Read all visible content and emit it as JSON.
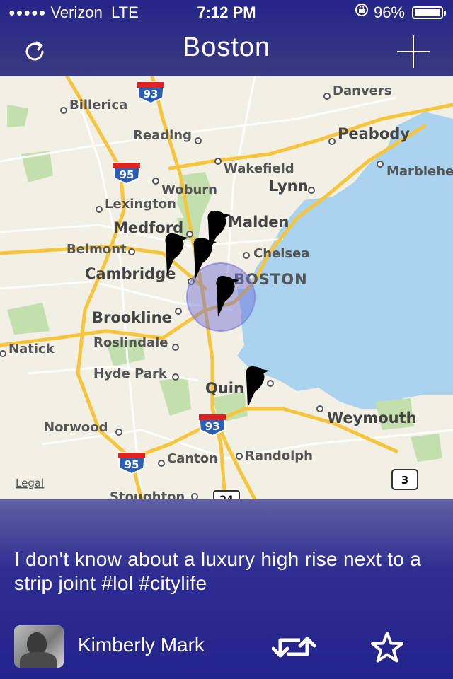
{
  "status_bar": {
    "signal_dots": "●●●●●",
    "carrier": "Verizon",
    "network": "LTE",
    "time": "7:12 PM",
    "battery_percent": "96%",
    "battery_level": 0.96
  },
  "navbar": {
    "title": "Boston",
    "refresh_icon": "refresh-icon",
    "add_icon": "plus-icon"
  },
  "map": {
    "legal_label": "Legal",
    "places": {
      "danvers": "Danvers",
      "billerica": "Billerica",
      "reading": "Reading",
      "peabody": "Peabody",
      "wakefield": "Wakefield",
      "marblehead": "Marblehe",
      "woburn": "Woburn",
      "lynn": "Lynn",
      "lexington": "Lexington",
      "malden": "Malden",
      "medford": "Medford",
      "belmont": "Belmont",
      "chelsea": "Chelsea",
      "cambridge": "Cambridge",
      "boston": "BOSTON",
      "brookline": "Brookline",
      "natick": "Natick",
      "roslindale": "Roslindale",
      "hyde_park": "Hyde Park",
      "quincy": "Quin",
      "weymouth": "Weymouth",
      "norwood": "Norwood",
      "canton": "Canton",
      "randolph": "Randolph",
      "stoughton": "Stoughton"
    },
    "shields": {
      "i93_north": "93",
      "i95_west": "95",
      "i93_south": "93",
      "i95_south": "95",
      "route_3": "3",
      "route_24": "24"
    },
    "colors": {
      "water": "#a9d3ee",
      "land": "#f2efe4",
      "park": "#c4dfae",
      "highway": "#f7c53b",
      "pin": "#000000"
    }
  },
  "tweet": {
    "text": "I don't know about a luxury high rise next to a strip joint #lol #citylife",
    "user_name": "Kimberly Mark",
    "retweet_icon": "retweet-icon",
    "favorite_icon": "star-icon"
  }
}
